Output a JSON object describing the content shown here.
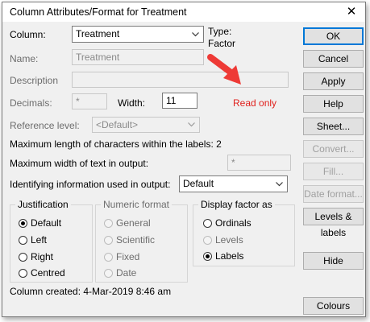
{
  "dialog": {
    "title": "Column Attributes/Format for Treatment",
    "close_glyph": "✕"
  },
  "column": {
    "label": "Column:",
    "value": "Treatment"
  },
  "type": {
    "label": "Type:",
    "value": "Factor"
  },
  "name": {
    "label": "Name:",
    "value": "Treatment"
  },
  "description": {
    "label": "Description",
    "value": ""
  },
  "decimals": {
    "label": "Decimals:",
    "value": "*"
  },
  "width": {
    "label": "Width:",
    "value": "11"
  },
  "annotation": {
    "text": "Read only",
    "color": "#e0201c"
  },
  "reference_level": {
    "label": "Reference level:",
    "value": "<Default>"
  },
  "max_length_text": "Maximum length of characters within the labels: 2",
  "max_width": {
    "label": "Maximum width of text in output:",
    "value": "*"
  },
  "identifying": {
    "label": "Identifying information used in output:",
    "value": "Default"
  },
  "justification": {
    "label": "Justification",
    "options": [
      "Default",
      "Left",
      "Right",
      "Centred"
    ],
    "selected": "Default"
  },
  "numeric_format": {
    "label": "Numeric format",
    "options": [
      "General",
      "Scientific",
      "Fixed",
      "Date"
    ]
  },
  "display_factor": {
    "label": "Display  factor as",
    "options": [
      "Ordinals",
      "Levels",
      "Labels"
    ],
    "selected": "Labels"
  },
  "buttons": {
    "ok": "OK",
    "cancel": "Cancel",
    "apply": "Apply",
    "help": "Help",
    "sheet": "Sheet...",
    "convert": "Convert...",
    "fill": "Fill...",
    "date_format": "Date format...",
    "levels_labels": "Levels & labels",
    "hide": "Hide",
    "colours": "Colours"
  },
  "status": "Column created: 4-Mar-2019 8:46 am",
  "icons": {
    "close": "close-icon",
    "dropdown": "chevron-down-icon",
    "arrow": "arrow-icon"
  }
}
